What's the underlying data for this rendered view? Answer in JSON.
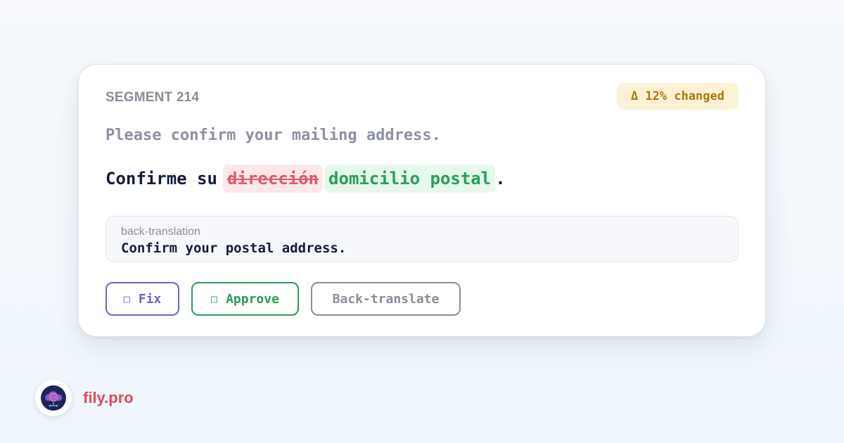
{
  "segment": {
    "label": "SEGMENT 214",
    "change_badge": "Δ 12% changed"
  },
  "source_text": "Please confirm your mailing address.",
  "target": {
    "prefix": "Confirme su",
    "deleted": "dirección",
    "inserted": "domicilio postal",
    "suffix": "."
  },
  "back_translation": {
    "label": "back-translation",
    "text": "Confirm your postal address."
  },
  "actions": {
    "fix": {
      "glyph": "□",
      "label": "Fix"
    },
    "approve": {
      "glyph": "□",
      "label": "Approve"
    },
    "back_translate": {
      "label": "Back-translate"
    }
  },
  "brand": {
    "name": "fily.pro"
  },
  "colors": {
    "accent_fix": "#6a64c8",
    "accent_approve": "#2e9a5a",
    "deleted": "#e05a68",
    "inserted": "#27a05a",
    "badge_text": "#a9780f",
    "brand": "#e04a5e"
  },
  "icons": {
    "logo": "cloud-globe-logo-icon"
  }
}
